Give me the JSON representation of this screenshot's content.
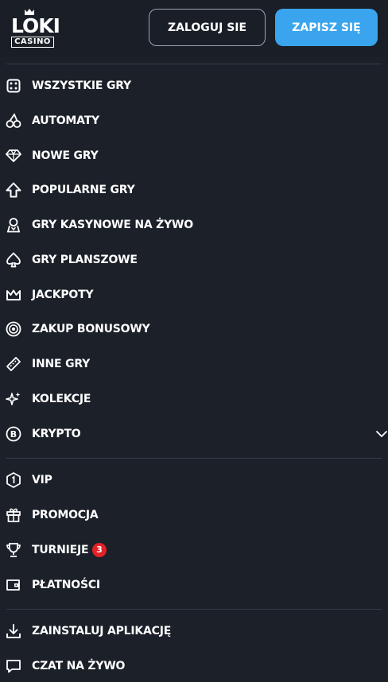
{
  "header": {
    "logo_word": "LOKI",
    "logo_sub": "CASINO",
    "login_label": "ZALOGUJ SIE",
    "signup_label": "ZAPISZ SIĘ"
  },
  "colors": {
    "background": "#1b2029",
    "accent": "#3aa5ee",
    "badge": "#e32227",
    "separator": "#353b45"
  },
  "menu": {
    "games": [
      {
        "label": "WSZYSTKIE GRY",
        "icon": "dice-icon"
      },
      {
        "label": "AUTOMATY",
        "icon": "cherries-icon"
      },
      {
        "label": "NOWE GRY",
        "icon": "diamond-icon"
      },
      {
        "label": "POPULARNE GRY",
        "icon": "arrow-up-icon"
      },
      {
        "label": "GRY KASYNOWE NA ŻYWO",
        "icon": "live-dealer-icon"
      },
      {
        "label": "GRY PLANSZOWE",
        "icon": "spade-icon"
      },
      {
        "label": "JACKPOTY",
        "icon": "crown-icon"
      },
      {
        "label": "ZAKUP BONUSOWY",
        "icon": "chip-icon"
      },
      {
        "label": "INNE GRY",
        "icon": "ticket-icon"
      },
      {
        "label": "KOLEKCJE",
        "icon": "sparkles-icon"
      },
      {
        "label": "KRYPTO",
        "icon": "bitcoin-icon"
      }
    ],
    "account": [
      {
        "label": "VIP",
        "icon": "vip-hexagon-icon"
      },
      {
        "label": "PROMOCJA",
        "icon": "gift-icon"
      },
      {
        "label": "TURNIEJE",
        "icon": "trophy-icon",
        "badge": "3"
      },
      {
        "label": "PŁATNOŚCI",
        "icon": "wallet-icon"
      }
    ],
    "app": [
      {
        "label": "ZAINSTALUJ APLIKACJĘ",
        "icon": "download-icon"
      },
      {
        "label": "CZAT NA ŻYWO",
        "icon": "chat-icon"
      }
    ]
  }
}
